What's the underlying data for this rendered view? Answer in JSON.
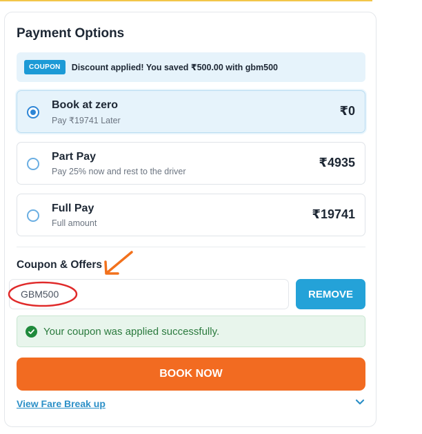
{
  "title": "Payment Options",
  "coupon_banner": {
    "tag": "COUPON",
    "text": "Discount applied! You saved ₹500.00 with gbm500"
  },
  "options": [
    {
      "name": "Book at zero",
      "sub": "Pay ₹19741 Later",
      "price": "₹0",
      "selected": true
    },
    {
      "name": "Part Pay",
      "sub": "Pay 25% now and rest to the driver",
      "price": "₹4935",
      "selected": false
    },
    {
      "name": "Full Pay",
      "sub": "Full amount",
      "price": "₹19741",
      "selected": false
    }
  ],
  "coupon_section": {
    "title": "Coupon & Offers",
    "input_value": "GBM500",
    "remove_label": "REMOVE",
    "success_text": "Your coupon was applied successfully."
  },
  "book_label": "BOOK NOW",
  "fare_link": "View Fare Break up",
  "colors": {
    "accent_blue": "#24a2d8",
    "book_orange": "#f26b21",
    "success_green": "#1f8a3c",
    "annotation_red": "#e02a2a",
    "annotation_arrow": "#f2711c"
  }
}
